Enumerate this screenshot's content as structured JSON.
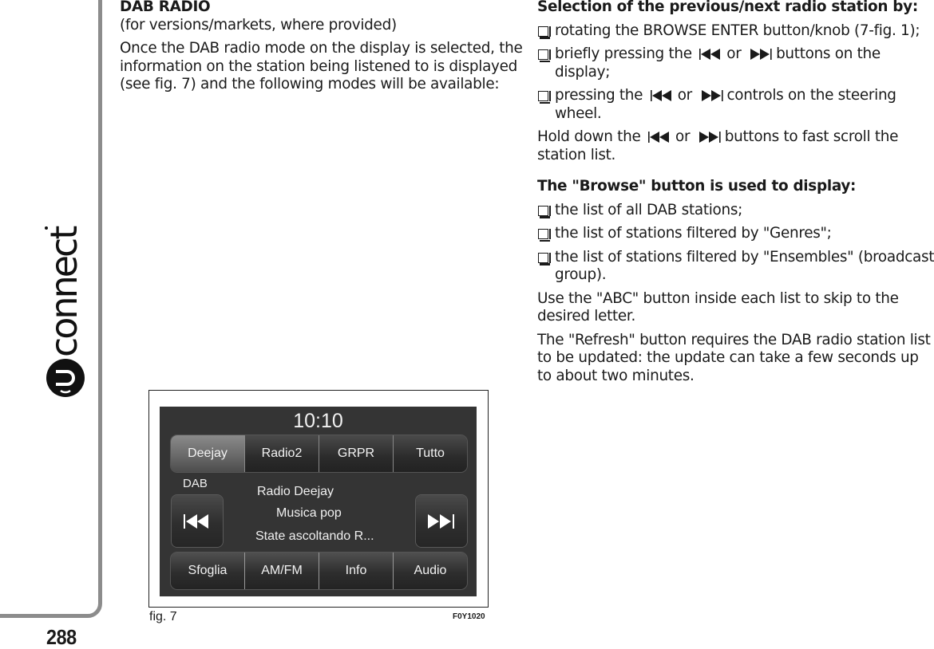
{
  "page": {
    "number": "288",
    "brand": "uconnect"
  },
  "left_column": {
    "heading": "DAB RADIO",
    "subheading": "(for versions/markets, where provided)",
    "intro": "Once the DAB radio mode on the display is selected, the information on the station being listened to is displayed (see fig. 7) and the following modes will be available:"
  },
  "figure": {
    "caption": "fig. 7",
    "code": "F0Y1020",
    "screen": {
      "clock": "10:10",
      "preset_tabs": [
        {
          "label": "Deejay",
          "active": true
        },
        {
          "label": "Radio2",
          "active": false
        },
        {
          "label": "GRPR",
          "active": false
        },
        {
          "label": "Tutto",
          "active": false
        }
      ],
      "band": "DAB",
      "station_name": "Radio Deejay",
      "genre": "Musica pop",
      "radio_text": "State ascoltando R...",
      "prev_icon": "skip-previous-icon",
      "next_icon": "skip-next-icon",
      "bottom_tabs": [
        {
          "label": "Sfoglia"
        },
        {
          "label": "AM/FM"
        },
        {
          "label": "Info"
        },
        {
          "label": "Audio"
        }
      ]
    }
  },
  "right_column": {
    "selection_heading": "Selection of the previous/next radio station by:",
    "selection_items": [
      {
        "text": "rotating the BROWSE ENTER button/knob (7-fig. 1);"
      },
      {
        "pre": "briefly pressing the",
        "mid": "or",
        "post": "buttons on the display;"
      },
      {
        "pre": "pressing the",
        "mid": "or",
        "post": "controls on the steering wheel."
      }
    ],
    "hold": {
      "pre": "Hold down the",
      "mid": "or",
      "post": "buttons to fast scroll the station list."
    },
    "browse_heading": "The \"Browse\" button is used to display:",
    "browse_items": [
      "the list of all DAB stations;",
      "the list of stations filtered by \"Genres\";",
      "the list of stations filtered by \"Ensembles\" (broadcast group)."
    ],
    "abc_text": "Use the \"ABC\" button inside each list to skip to the desired letter.",
    "refresh_text": "The \"Refresh\" button requires the DAB radio station list to be updated: the update can take a few seconds up to about two minutes."
  }
}
